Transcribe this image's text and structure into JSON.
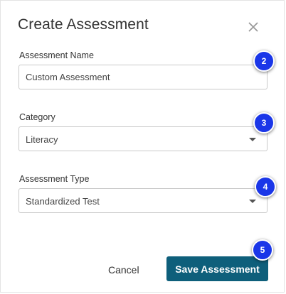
{
  "dialog": {
    "title": "Create Assessment",
    "close_icon": "close-icon"
  },
  "fields": {
    "name": {
      "label": "Assessment Name",
      "value": "Custom Assessment"
    },
    "category": {
      "label": "Category",
      "value": "Literacy"
    },
    "type": {
      "label": "Assessment Type",
      "value": "Standardized Test"
    }
  },
  "buttons": {
    "cancel": "Cancel",
    "save": "Save Assessment"
  },
  "badges": [
    "2",
    "3",
    "4",
    "5"
  ],
  "colors": {
    "primary_button": "#0e5f7b",
    "badge": "#1a36e8",
    "border": "#c9c9c9",
    "text": "#333333"
  }
}
